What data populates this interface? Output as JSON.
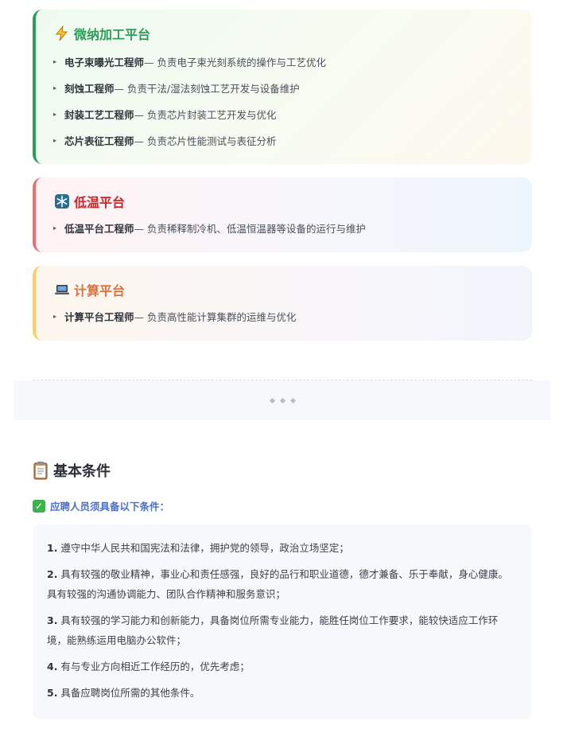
{
  "platforms": [
    {
      "icon": "lightning-icon",
      "title": "微纳加工平台",
      "items": [
        {
          "role": "电子束曝光工程师",
          "desc": " — 负责电子束光刻系统的操作与工艺优化"
        },
        {
          "role": "刻蚀工程师",
          "desc": " — 负责干法/湿法刻蚀工艺开发与设备维护"
        },
        {
          "role": "封装工艺工程师",
          "desc": " — 负责芯片封装工艺开发与优化"
        },
        {
          "role": "芯片表征工程师",
          "desc": " — 负责芯片性能测试与表征分析"
        }
      ]
    },
    {
      "icon": "snowflake-icon",
      "title": "低温平台",
      "items": [
        {
          "role": "低温平台工程师",
          "desc": " — 负责稀释制冷机、低温恒温器等设备的运行与维护"
        }
      ]
    },
    {
      "icon": "laptop-icon",
      "title": "计算平台",
      "items": [
        {
          "role": "计算平台工程师",
          "desc": " — 负责高性能计算集群的运维与优化"
        }
      ]
    }
  ],
  "basic": {
    "title": "基本条件",
    "icon": "clipboard-icon",
    "subtitle": "应聘人员须具备以下条件：",
    "conditions": [
      {
        "num": "1.",
        "text": " 遵守中华人民共和国宪法和法律，拥护党的领导，政治立场坚定；"
      },
      {
        "num": "2.",
        "text": " 具有较强的敬业精神，事业心和责任感强，良好的品行和职业道德，德才兼备、乐于奉献，身心健康。具有较强的沟通协调能力、团队合作精神和服务意识；"
      },
      {
        "num": "3.",
        "text": " 具有较强的学习能力和创新能力，具备岗位所需专业能力，能胜任岗位工作要求，能较快适应工作环境，能熟练运用电脑办公软件；"
      },
      {
        "num": "4.",
        "text": " 有与专业方向相近工作经历的，优先考虑；"
      },
      {
        "num": "5.",
        "text": " 具备应聘岗位所需的其他条件。"
      }
    ]
  },
  "colors": {
    "micro_accent": "#2e9d5b",
    "cryo_accent": "#c62828",
    "compute_accent": "#e0703a",
    "subtitle_blue": "#4a6fd1"
  }
}
